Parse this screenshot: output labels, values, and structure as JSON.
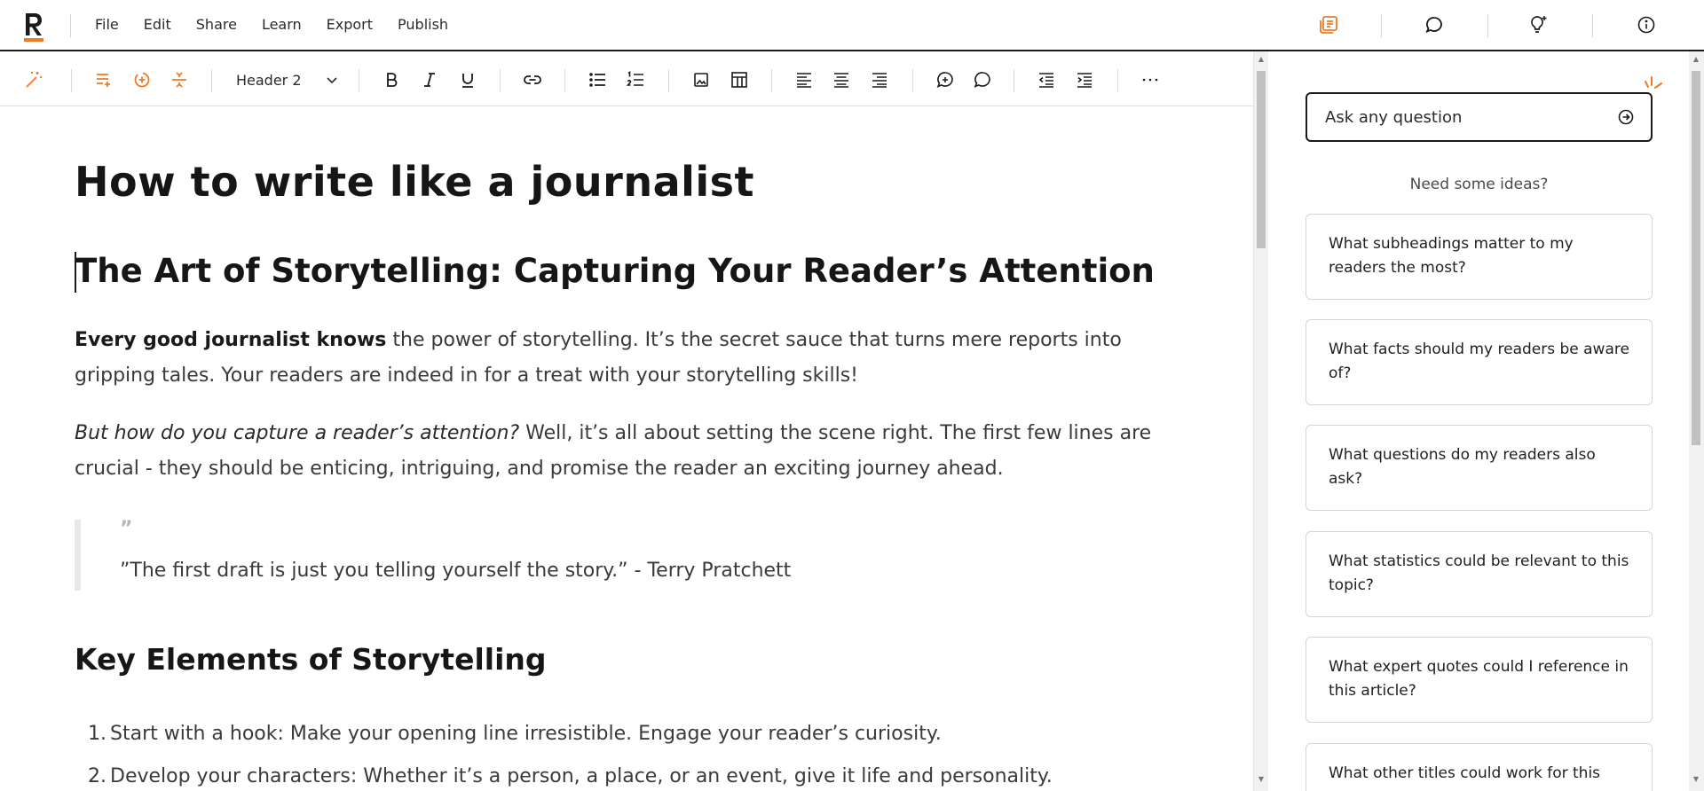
{
  "colors": {
    "accent": "#f07a22",
    "text": "#1a1a1a"
  },
  "menu": {
    "items": [
      {
        "label": "File"
      },
      {
        "label": "Edit"
      },
      {
        "label": "Share"
      },
      {
        "label": "Learn"
      },
      {
        "label": "Export"
      },
      {
        "label": "Publish"
      }
    ]
  },
  "top_icons": [
    "document-panel-icon",
    "chat-bubble-icon",
    "lightbulb-icon",
    "info-icon"
  ],
  "toolbar": {
    "text_style": "Header 2",
    "icons": [
      "magic-wand-icon",
      "add-section-icon",
      "ai-rewrite-icon",
      "page-break-icon",
      "bold-icon",
      "italic-icon",
      "underline-icon",
      "link-icon",
      "bullet-list-icon",
      "numbered-list-icon",
      "image-icon",
      "table-icon",
      "align-left-icon",
      "align-center-icon",
      "align-right-icon",
      "add-comment-icon",
      "comment-icon",
      "outdent-icon",
      "indent-icon",
      "more-icon"
    ]
  },
  "document": {
    "title": "How to write like a journalist",
    "heading": "The Art of Storytelling: Capturing Your Reader’s Attention",
    "p1_bold": "Every good journalist knows",
    "p1_rest": " the power of storytelling. It’s the secret sauce that turns mere reports into gripping tales. Your readers are indeed in for a treat with your storytelling skills!",
    "p2_italic": "But how do you capture a reader’s attention?",
    "p2_rest": " Well, it’s all about setting the scene right. The first few lines are crucial - they should be enticing, intriguing, and promise the reader an exciting journey ahead.",
    "quote_mark": "”",
    "quote": "”The first draft is just you telling yourself the story.” - Terry Pratchett",
    "subheading": "Key Elements of Storytelling",
    "list": [
      {
        "num": "1.",
        "text": "Start with a hook: Make your opening line irresistible. Engage your reader’s curiosity."
      },
      {
        "num": "2.",
        "text": "Develop your characters: Whether it’s a person, a place, or an event, give it life and personality."
      }
    ]
  },
  "assistant": {
    "ask_placeholder": "Ask any question",
    "ideas_label": "Need some ideas?",
    "suggestions": [
      "What subheadings matter to my readers the most?",
      "What facts should my readers be aware of?",
      "What questions do my readers also ask?",
      "What statistics could be relevant to this topic?",
      "What expert quotes could I reference in this article?",
      "What other titles could work for this"
    ]
  }
}
